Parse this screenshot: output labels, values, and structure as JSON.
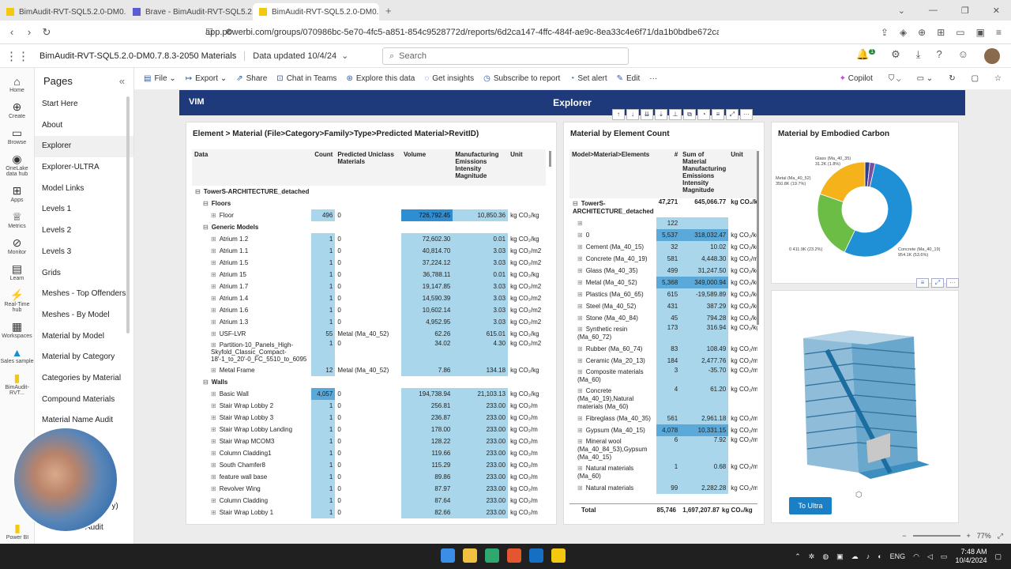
{
  "browser": {
    "tabs": [
      {
        "label": "BimAudit-RVT-SQL5.2.0-DM0.7.8.3"
      },
      {
        "label": "Brave - BimAudit-RVT-SQL5.2.0-DM"
      },
      {
        "label": "BimAudit-RVT-SQL5.2.0-DM0.7"
      }
    ],
    "url": "app.powerbi.com/groups/070986bc-5e70-4fc5-a851-854c9528772d/reports/6d2ca147-4ffc-484f-ae9c-8ea33c4e6f71/da1b0bdbe672ca89010a?experienc..."
  },
  "header": {
    "report_title": "BimAudit-RVT-SQL5.2.0-DM0.7.8.3-2050 Materials",
    "updated": "Data updated 10/4/24",
    "search_placeholder": "Search",
    "notif_count": "1"
  },
  "rail": [
    {
      "label": "Home",
      "icon": "home-icon"
    },
    {
      "label": "Create",
      "icon": "plus-icon"
    },
    {
      "label": "Browse",
      "icon": "folder-icon"
    },
    {
      "label": "OneLake data hub",
      "icon": "onelake-icon"
    },
    {
      "label": "Apps",
      "icon": "apps-icon"
    },
    {
      "label": "Metrics",
      "icon": "trophy-icon"
    },
    {
      "label": "Monitor",
      "icon": "monitor-icon"
    },
    {
      "label": "Learn",
      "icon": "book-icon"
    },
    {
      "label": "Real-Time hub",
      "icon": "realtime-icon"
    },
    {
      "label": "Workspaces",
      "icon": "workspaces-icon"
    },
    {
      "label": "Sales sample",
      "icon": "sales-icon"
    },
    {
      "label": "BimAudit-RVT...",
      "icon": "report-icon"
    }
  ],
  "pages": {
    "title": "Pages",
    "items": [
      "Start Here",
      "About",
      "Explorer",
      "Explorer-ULTRA",
      "Model Links",
      "Levels 1",
      "Levels 2",
      "Levels 3",
      "Grids",
      "Meshes - Top Offenders",
      "Meshes - By Model",
      "Material by Model",
      "Material by Category",
      "Categories by Material",
      "Compound Materials",
      "Material Name Audit"
    ],
    "partial": [
      "ry)",
      "Audit"
    ]
  },
  "toolbar": {
    "file": "File",
    "export": "Export",
    "share": "Share",
    "chat": "Chat in Teams",
    "explore": "Explore this data",
    "insights": "Get insights",
    "subscribe": "Subscribe to report",
    "alert": "Set alert",
    "edit": "Edit",
    "copilot": "Copilot"
  },
  "banner": {
    "logo": "VIM",
    "title": "Explorer"
  },
  "left_table": {
    "title": "Element > Material (File>Category>Family>Type>Predicted Material>RevitID)",
    "headers": [
      "Data",
      "Count",
      "Predicted Uniclass Materials",
      "Volume",
      "Manufacturing Emissions Intensity Magnitude",
      "Unit"
    ],
    "rows": [
      {
        "level": 0,
        "name": "TowerS-ARCHITECTURE_detached",
        "count": "",
        "mat": "",
        "vol": "",
        "em": "",
        "unit": "",
        "group": true
      },
      {
        "level": 1,
        "name": "Floors",
        "count": "",
        "mat": "",
        "vol": "",
        "em": "",
        "unit": "",
        "group": true
      },
      {
        "level": 2,
        "name": "Floor",
        "count": "496",
        "mat": "0",
        "vol": "726,792.45",
        "em": "10,850.36",
        "unit": "kg CO₂/kg",
        "big": true
      },
      {
        "level": 1,
        "name": "Generic Models",
        "count": "",
        "mat": "",
        "vol": "",
        "em": "",
        "unit": "",
        "group": true
      },
      {
        "level": 2,
        "name": "Atrium 1.2",
        "count": "1",
        "mat": "0",
        "vol": "72,602.30",
        "em": "0.01",
        "unit": "kg CO₂/kg"
      },
      {
        "level": 2,
        "name": "Atrium 1.1",
        "count": "1",
        "mat": "0",
        "vol": "40,814.70",
        "em": "3.03",
        "unit": "kg CO₂/m2"
      },
      {
        "level": 2,
        "name": "Atrium 1.5",
        "count": "1",
        "mat": "0",
        "vol": "37,224.12",
        "em": "3.03",
        "unit": "kg CO₂/m2"
      },
      {
        "level": 2,
        "name": "Atrium 15",
        "count": "1",
        "mat": "0",
        "vol": "36,788.11",
        "em": "0.01",
        "unit": "kg CO₂/kg"
      },
      {
        "level": 2,
        "name": "Atrium 1.7",
        "count": "1",
        "mat": "0",
        "vol": "19,147.85",
        "em": "3.03",
        "unit": "kg CO₂/m2"
      },
      {
        "level": 2,
        "name": "Atrium 1.4",
        "count": "1",
        "mat": "0",
        "vol": "14,590.39",
        "em": "3.03",
        "unit": "kg CO₂/m2"
      },
      {
        "level": 2,
        "name": "Atrium 1.6",
        "count": "1",
        "mat": "0",
        "vol": "10,602.14",
        "em": "3.03",
        "unit": "kg CO₂/m2"
      },
      {
        "level": 2,
        "name": "Atrium 1.3",
        "count": "1",
        "mat": "0",
        "vol": "4,952.95",
        "em": "3.03",
        "unit": "kg CO₂/m2"
      },
      {
        "level": 2,
        "name": "USF-LVR",
        "count": "55",
        "mat": "Metal (Ma_40_52)",
        "vol": "62.26",
        "em": "615.01",
        "unit": "kg CO₂/kg"
      },
      {
        "level": 2,
        "name": "Partition-10_Panels_High-Skyfold_Classic_Compact-18'-1_to_20'-0_FC_5510_to_6095",
        "count": "1",
        "mat": "0",
        "vol": "34.02",
        "em": "4.30",
        "unit": "kg CO₂/m2",
        "tall": true
      },
      {
        "level": 2,
        "name": "Metal Frame",
        "count": "12",
        "mat": "Metal (Ma_40_52)",
        "vol": "7.86",
        "em": "134.18",
        "unit": "kg CO₂/kg"
      },
      {
        "level": 1,
        "name": "Walls",
        "count": "",
        "mat": "",
        "vol": "",
        "em": "",
        "unit": "",
        "group": true
      },
      {
        "level": 2,
        "name": "Basic Wall",
        "count": "4,057",
        "mat": "0",
        "vol": "194,738.94",
        "em": "21,103.13",
        "unit": "kg CO₂/kg",
        "bigcount": true
      },
      {
        "level": 2,
        "name": "Stair Wrap Lobby 2",
        "count": "1",
        "mat": "0",
        "vol": "256.81",
        "em": "233.00",
        "unit": "kg CO₂/m"
      },
      {
        "level": 2,
        "name": "Stair Wrap Lobby 3",
        "count": "1",
        "mat": "0",
        "vol": "236.87",
        "em": "233.00",
        "unit": "kg CO₂/m"
      },
      {
        "level": 2,
        "name": "Stair Wrap Lobby Landing",
        "count": "1",
        "mat": "0",
        "vol": "178.00",
        "em": "233.00",
        "unit": "kg CO₂/m"
      },
      {
        "level": 2,
        "name": "Stair Wrap MCOM3",
        "count": "1",
        "mat": "0",
        "vol": "128.22",
        "em": "233.00",
        "unit": "kg CO₂/m"
      },
      {
        "level": 2,
        "name": "Column Cladding1",
        "count": "1",
        "mat": "0",
        "vol": "119.66",
        "em": "233.00",
        "unit": "kg CO₂/m"
      },
      {
        "level": 2,
        "name": "South Chamfer8",
        "count": "1",
        "mat": "0",
        "vol": "115.29",
        "em": "233.00",
        "unit": "kg CO₂/m"
      },
      {
        "level": 2,
        "name": "feature wall base",
        "count": "1",
        "mat": "0",
        "vol": "89.86",
        "em": "233.00",
        "unit": "kg CO₂/m"
      },
      {
        "level": 2,
        "name": "Revolver Wing",
        "count": "1",
        "mat": "0",
        "vol": "87.97",
        "em": "233.00",
        "unit": "kg CO₂/m"
      },
      {
        "level": 2,
        "name": "Column Cladding",
        "count": "1",
        "mat": "0",
        "vol": "87.64",
        "em": "233.00",
        "unit": "kg CO₂/m"
      },
      {
        "level": 2,
        "name": "Stair Wrap Lobby 1",
        "count": "1",
        "mat": "0",
        "vol": "82.66",
        "em": "233.00",
        "unit": "kg CO₂/m"
      }
    ]
  },
  "mid_table": {
    "title": "Material by Element Count",
    "headers": [
      "Model>Material>Elements",
      "#",
      "Sum of Material Manufacturing Emissions Intensity Magnitude",
      "Unit"
    ],
    "rows": [
      {
        "name": "TowerS-ARCHITECTURE_detached",
        "count": "47,271",
        "sum": "645,066.77",
        "unit": "kg CO₂/kg",
        "group": true,
        "tall": true
      },
      {
        "name": "",
        "count": "122",
        "sum": "",
        "unit": ""
      },
      {
        "name": "0",
        "count": "5,537",
        "sum": "318,032.47",
        "unit": "kg CO₂/kg",
        "hl": true
      },
      {
        "name": "Cement (Ma_40_15)",
        "count": "32",
        "sum": "10.02",
        "unit": "kg CO₂/kg"
      },
      {
        "name": "Concrete (Ma_40_19)",
        "count": "581",
        "sum": "4,448.30",
        "unit": "kg CO₂/m2"
      },
      {
        "name": "Glass (Ma_40_35)",
        "count": "499",
        "sum": "31,247.50",
        "unit": "kg CO₂/kg"
      },
      {
        "name": "Metal (Ma_40_52)",
        "count": "5,368",
        "sum": "349,000.94",
        "unit": "kg CO₂/kg",
        "hl": true
      },
      {
        "name": "Plastics (Ma_60_65)",
        "count": "615",
        "sum": "-19,589.89",
        "unit": "kg CO₂/kg"
      },
      {
        "name": "Steel (Ma_40_52)",
        "count": "431",
        "sum": "387.29",
        "unit": "kg CO₂/kg"
      },
      {
        "name": "Stone (Ma_40_84)",
        "count": "45",
        "sum": "794.28",
        "unit": "kg CO₂/kg"
      },
      {
        "name": "Synthetic resin (Ma_60_72)",
        "count": "173",
        "sum": "316.94",
        "unit": "kg CO₂/kg",
        "tall": true
      },
      {
        "name": "Rubber (Ma_60_74)",
        "count": "83",
        "sum": "108.49",
        "unit": "kg CO₂/m"
      },
      {
        "name": "Ceramic (Ma_20_13)",
        "count": "184",
        "sum": "2,477.76",
        "unit": "kg CO₂/m2"
      },
      {
        "name": "Composite materials (Ma_60)",
        "count": "3",
        "sum": "-35.70",
        "unit": "kg CO₂/m2",
        "tall": true
      },
      {
        "name": "Concrete (Ma_40_19),Natural materials (Ma_60)",
        "count": "4",
        "sum": "61.20",
        "unit": "kg CO₂/m2",
        "tall3": true
      },
      {
        "name": "Fibreglass (Ma_40_35)",
        "count": "561",
        "sum": "2,961.18",
        "unit": "kg CO₂/m2"
      },
      {
        "name": "Gypsum (Ma_40_15)",
        "count": "4,078",
        "sum": "10,331.15",
        "unit": "kg CO₂/m2",
        "hl": true
      },
      {
        "name": "Mineral wool (Ma_40_84_53),Gypsum (Ma_40_15)",
        "count": "6",
        "sum": "7.92",
        "unit": "kg CO₂/m2",
        "tall3": true
      },
      {
        "name": "Natural materials (Ma_60)",
        "count": "1",
        "sum": "0.68",
        "unit": "kg CO₂/m2",
        "tall": true
      },
      {
        "name": "Natural materials",
        "count": "99",
        "sum": "2,282.28",
        "unit": "kg CO₂/m2"
      }
    ],
    "total": {
      "label": "Total",
      "count": "85,746",
      "sum": "1,697,207.87",
      "unit": "kg CO₂/kg"
    }
  },
  "chart_data": {
    "type": "pie",
    "title": "Material by Embodied Carbon",
    "donut": true,
    "slices": [
      {
        "label": "Concrete (Ma_40_19)",
        "value_label": "954.1K (53.6%)",
        "pct": 53.6,
        "color": "#1f8fd6"
      },
      {
        "label": "0",
        "value_label": "411.9K (23.2%)",
        "pct": 23.2,
        "color": "#6cbd45"
      },
      {
        "label": "Metal (Ma_40_52)",
        "value_label": "350.8K (19.7%)",
        "pct": 19.7,
        "color": "#f5b21a"
      },
      {
        "label": "Glass (Ma_40_35)",
        "value_label": "31.2K (1.8%)",
        "pct": 1.8,
        "color": "#7a4fa0"
      },
      {
        "label": "",
        "value_label": "",
        "pct": 1.7,
        "color": "#2b3f8f"
      }
    ]
  },
  "viewer": {
    "button": "To Ultra"
  },
  "status": {
    "zoom": "77%"
  },
  "taskbar": {
    "lang": "ENG",
    "time": "7:48 AM",
    "date": "10/4/2024"
  }
}
